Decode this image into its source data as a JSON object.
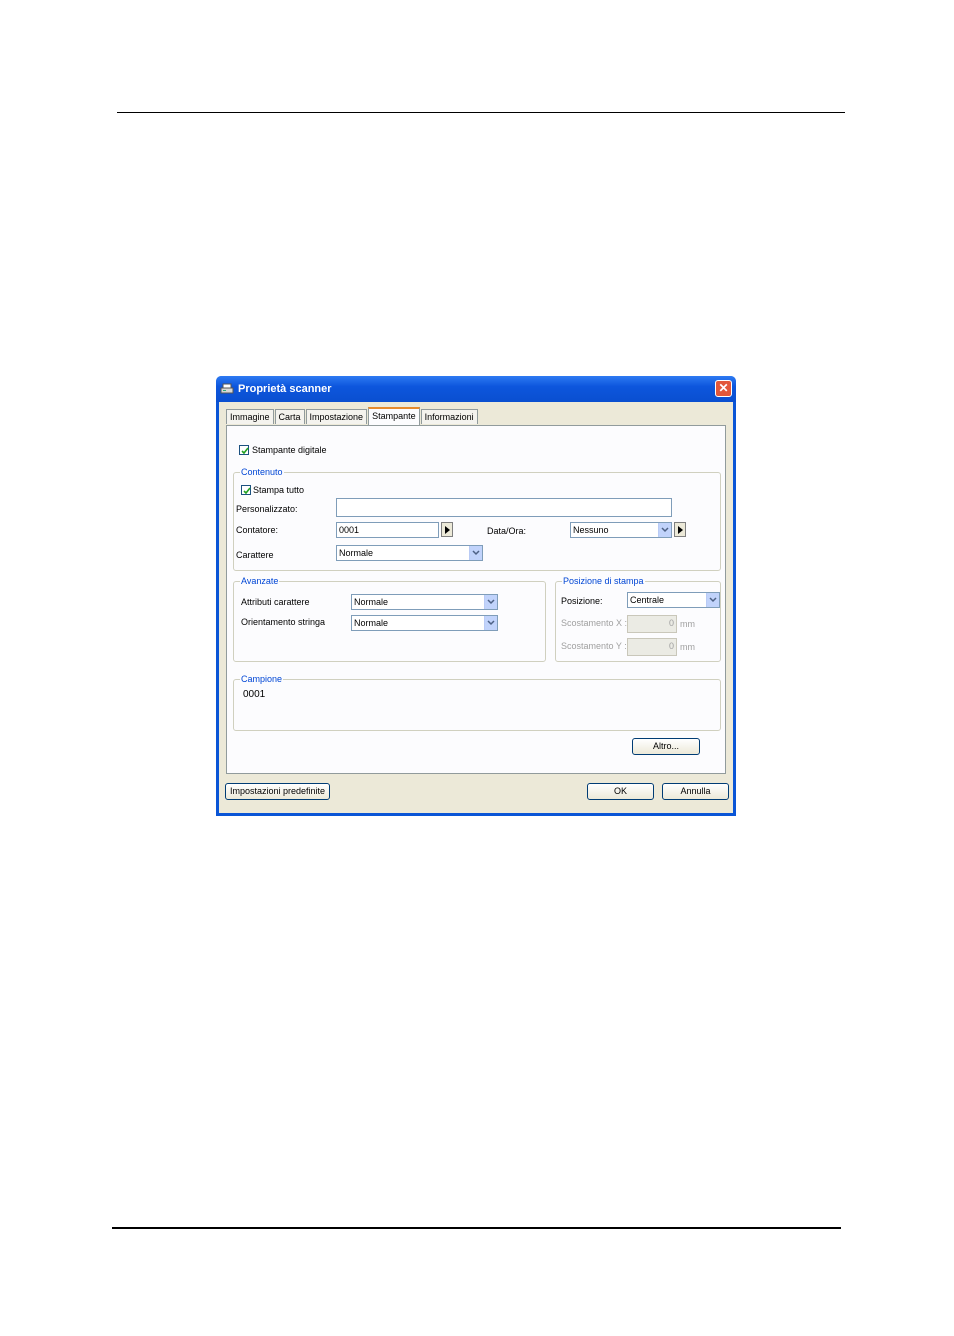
{
  "window": {
    "title": "Proprietà scanner",
    "close_glyph": "✕"
  },
  "tabs": [
    {
      "label": "Immagine",
      "active": false
    },
    {
      "label": "Carta",
      "active": false
    },
    {
      "label": "Impostazione",
      "active": false
    },
    {
      "label": "Stampante",
      "active": true
    },
    {
      "label": "Informazioni",
      "active": false
    }
  ],
  "printer": {
    "digital_printer_label": "Stampante digitale",
    "digital_printer_checked": true
  },
  "content": {
    "legend": "Contenuto",
    "print_all_label": "Stampa tutto",
    "print_all_checked": true,
    "custom_label": "Personalizzato:",
    "custom_value": "",
    "counter_label": "Contatore:",
    "counter_value": "0001",
    "datetime_label": "Data/Ora:",
    "datetime_value": "Nessuno",
    "font_label": "Carattere",
    "font_value": "Normale"
  },
  "advanced": {
    "legend": "Avanzate",
    "attributes_label": "Attributi carattere",
    "attributes_value": "Normale",
    "orientation_label": "Orientamento stringa",
    "orientation_value": "Normale"
  },
  "position": {
    "legend": "Posizione di stampa",
    "position_label": "Posizione:",
    "position_value": "Centrale",
    "offset_x_label": "Scostamento X :",
    "offset_x_value": "0",
    "offset_y_label": "Scostamento Y :",
    "offset_y_value": "0",
    "unit": "mm"
  },
  "sample": {
    "legend": "Campione",
    "text": "0001"
  },
  "buttons": {
    "other": "Altro...",
    "defaults": "Impostazioni predefinite",
    "ok": "OK",
    "cancel": "Annulla"
  },
  "colors": {
    "title_bar": "#0a55d6",
    "legend_text": "#0046d5",
    "close_button": "#e2573a",
    "active_tab_accent": "#e68b2c"
  }
}
